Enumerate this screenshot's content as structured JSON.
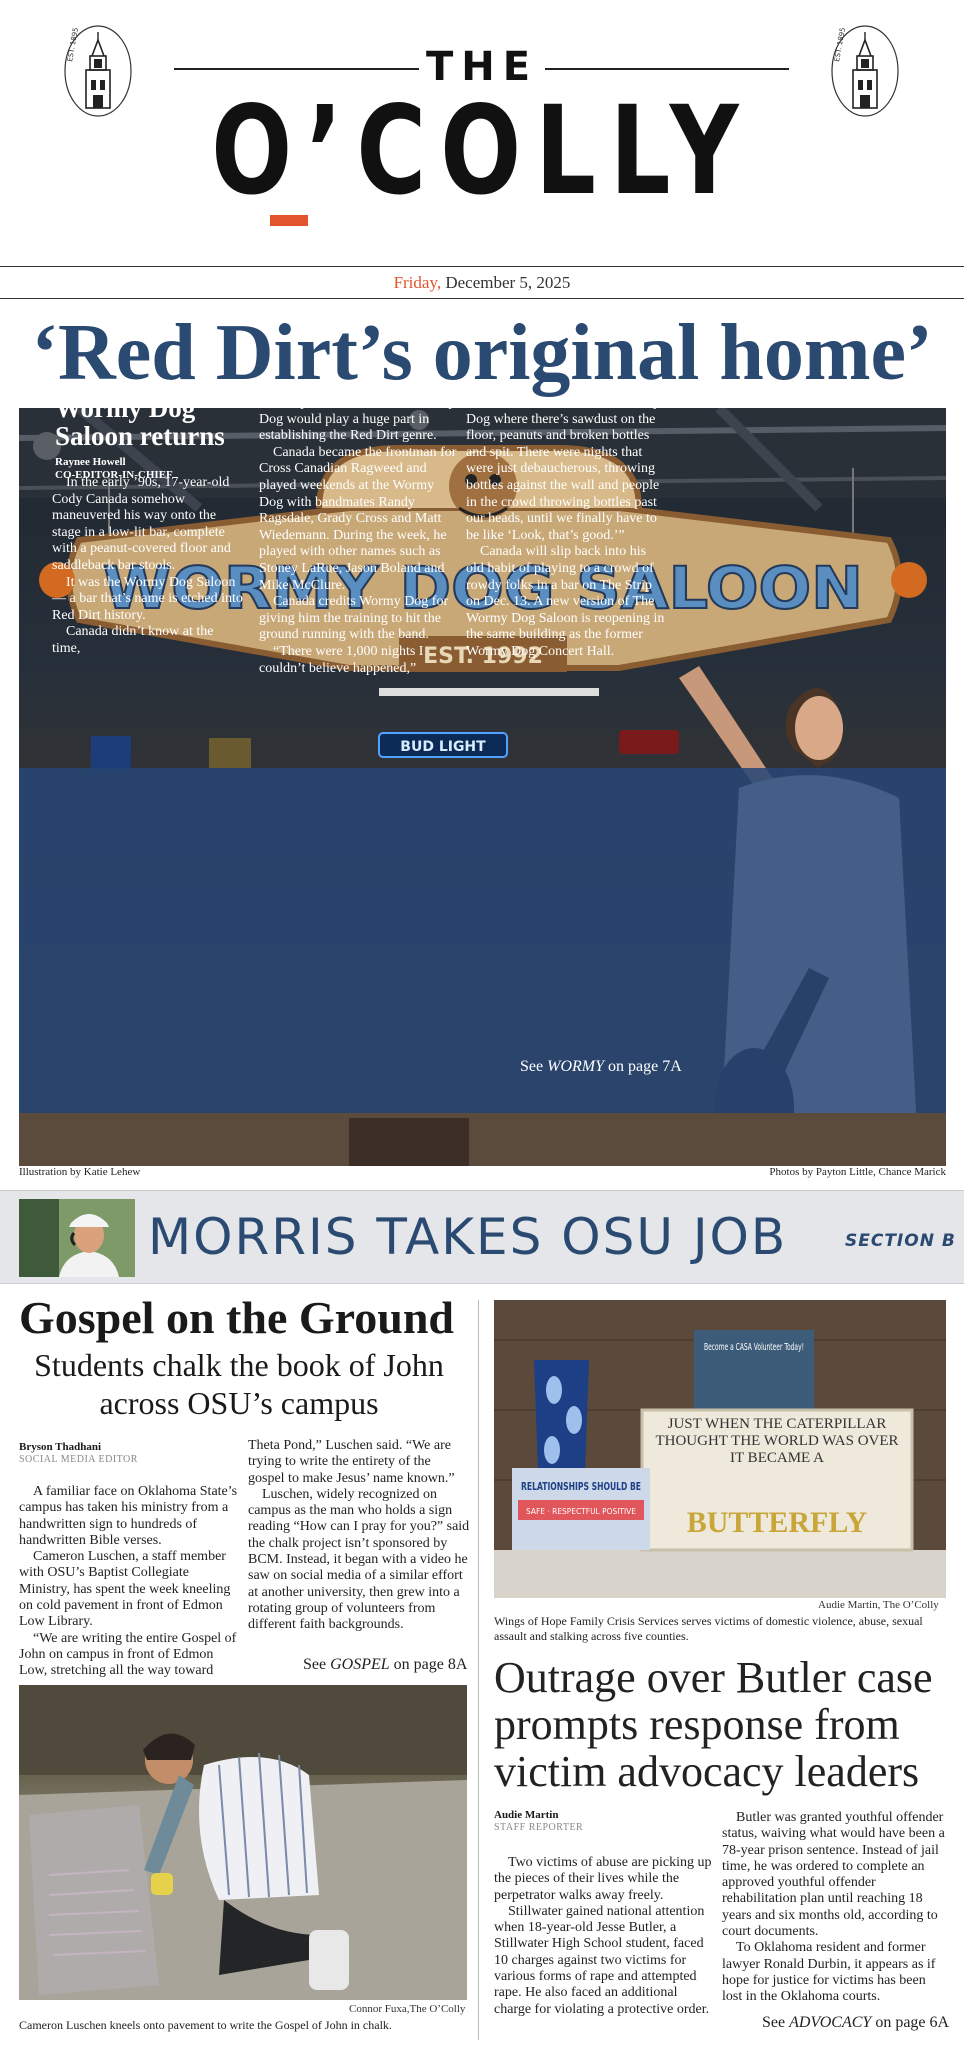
{
  "masthead": {
    "the": "THE",
    "title": "O’COLLY",
    "seal_text": "EST. 1895"
  },
  "dateline": {
    "day": "Friday,",
    "date": " December 5, 2025"
  },
  "lead": {
    "headline": "‘Red Dirt’s original home’",
    "sign_text": "WORMY DOG SALOON",
    "sign_est": "EST. 1992",
    "neon": "BUD LIGHT",
    "title": "Wormy Dog Saloon returns",
    "author": "Raynee Howell",
    "author_role": "CO-EDITOR-IN-CHIEF",
    "col1": [
      "In the early ’90s, 17-year-old Cody Canada somehow maneuvered his way onto the stage in a low-lit bar, complete with a peanut-covered floor and saddleback bar stools.",
      "It was the Wormy Dog Saloon — a bar that’s name is etched into Red Dirt history.",
      "Canada didn’t know at the time,"
    ],
    "col2_lead": "but his performances at the Wormy Dog would play a huge part in establishing the Red Dirt genre.",
    "col2": [
      "Canada became the frontman for Cross Canadian Ragweed and played weekends at the Wormy Dog with bandmates Randy Ragsdale, Grady Cross and Matt Wiedemann. During the week, he played with other names such as Stoney LaRue, Jason Boland and Mike McClure.",
      "Canada credits Wormy Dog for giving him the training to hit the ground running with the band.",
      "“There were 1,000 nights I couldn’t believe happened,”"
    ],
    "col3_lead": "Canada said. “We’re at the Wormy Dog where there’s sawdust on the floor, peanuts and broken bottles and spit. There were nights that were just debaucherous, throwing bottles against the wall and people in the crowd throwing bottles past our heads, until we finally have to be like ‘Look, that’s good.’”",
    "col3": [
      "Canada will slip back into his old habit of playing to a crowd of rowdy folks in a bar on The Strip on Dec. 13. A new version of The Wormy Dog Saloon is reopening in the same building as the former Wormy Dog Concert Hall."
    ],
    "jump_pre": "See ",
    "jump_word": "WORMY",
    "jump_post": " on page 7A",
    "credit_left": "Illustration by Katie Lehew",
    "credit_right": "Photos by Payton Little, Chance Marick"
  },
  "teaser": {
    "headline": "MORRIS TAKES OSU JOB",
    "section": "SECTION B"
  },
  "gospel": {
    "headline": "Gospel on the Ground",
    "dek": "Students chalk the book of John across OSU’s campus",
    "author": "Bryson Thadhani",
    "author_role": "SOCIAL MEDIA EDITOR",
    "col1": [
      "A familiar face on Oklahoma State’s campus has taken his ministry from a handwritten sign to hundreds of handwritten Bible verses.",
      "Cameron Luschen, a staff member with OSU’s Baptist Collegiate Ministry, has spent the week kneeling on cold pavement in front of Edmon Low Library.",
      "“We are writing the entire Gospel of John on campus in front of Edmon Low, stretching all the way toward"
    ],
    "col2_lead": "Theta Pond,” Luschen said. “We are trying to write the entirety of the gospel to make Jesus’ name known.”",
    "col2": [
      "Luschen, widely recognized on campus as the man who holds a sign reading “How can I pray for you?” said the chalk project isn’t sponsored by BCM. Instead, it began with a video he saw on social media of a similar effort at another university, then grew into a rotating group of volunteers from different faith backgrounds."
    ],
    "jump_pre": "See ",
    "jump_word": "GOSPEL",
    "jump_post": " on page 8A",
    "photo_credit": "Connor Fuxa,The O’Colly",
    "caption": "Cameron Luschen kneels onto pavement to write the Gospel of John in chalk."
  },
  "butler": {
    "photo_credit": "Audie Martin, The O’Colly",
    "caption": "Wings of Hope Family Crisis Services serves victims of domestic violence, abuse, sexual assault and stalking across five counties.",
    "sign_text": "JUST WHEN THE CATERPILLAR THOUGHT THE WORLD WAS OVER IT BECAME A",
    "sign_word": "BUTTERFLY",
    "card_text": "Become a CASA Volunteer Today!",
    "relationships": "RELATIONSHIPS SHOULD BE",
    "relationships_sub": "SAFE · RESPECTFUL POSITIVE",
    "headline": "Outrage over Butler case prompts response from victim advocacy leaders",
    "author": "Audie Martin",
    "author_role": "STAFF REPORTER",
    "col1": [
      "Two victims of abuse are picking up the pieces of their lives while the perpetrator walks away freely.",
      "Stillwater gained national attention when 18-year-old Jesse Butler, a Stillwater High School student, faced 10 charges against two victims for various forms of rape and attempted rape. He also faced an additional charge for violating a protective order."
    ],
    "col2": [
      "Butler was granted youthful offender status, waiving what would have been a 78-year prison sentence. Instead of jail time, he was ordered to complete an approved youthful offender rehabilitation plan until reaching 18 years and six months old, according to court documents.",
      "To Oklahoma resident and former lawyer Ronald Durbin, it appears as if hope for justice for victims has been lost in the Oklahoma courts."
    ],
    "jump_pre": "See ",
    "jump_word": "ADVOCACY",
    "jump_post": " on page 6A"
  },
  "colors": {
    "accent": "#e2542c",
    "navy": "#2b4a72",
    "panel": "#264676"
  }
}
